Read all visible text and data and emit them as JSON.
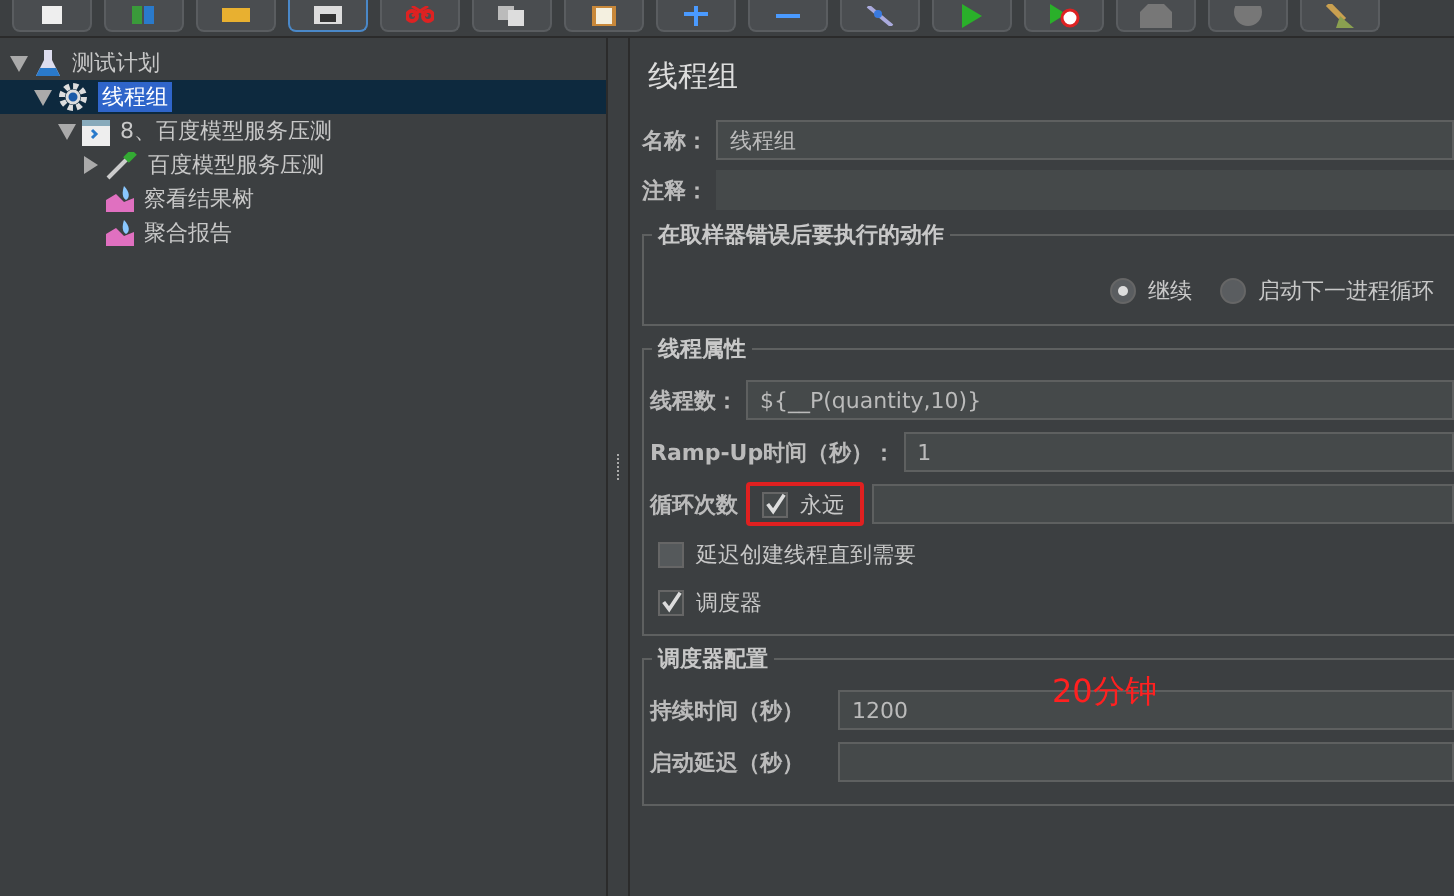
{
  "toolbar": [
    {
      "selected": false
    },
    {
      "selected": false
    },
    {
      "selected": false
    },
    {
      "selected": true
    },
    {
      "selected": false
    },
    {
      "selected": false
    },
    {
      "selected": false
    },
    {
      "selected": false
    },
    {
      "selected": false
    },
    {
      "selected": false
    },
    {
      "selected": false
    },
    {
      "selected": false
    },
    {
      "selected": false
    },
    {
      "selected": false
    },
    {
      "selected": false
    }
  ],
  "tree": [
    {
      "label": "测试计划",
      "kind": "plan",
      "expanded": true,
      "selected": false,
      "children": [
        {
          "label": "线程组",
          "kind": "thread-group",
          "expanded": true,
          "selected": true,
          "children": [
            {
              "label": "8、百度模型服务压测",
              "kind": "controller",
              "expanded": true,
              "selected": false,
              "children": [
                {
                  "label": "百度模型服务压测",
                  "kind": "sampler",
                  "expanded": false,
                  "selected": false
                },
                {
                  "label": "察看结果树",
                  "kind": "listener",
                  "selected": false
                },
                {
                  "label": "聚合报告",
                  "kind": "listener",
                  "selected": false
                }
              ]
            }
          ]
        }
      ]
    }
  ],
  "panel": {
    "title": "线程组",
    "name": {
      "label": "名称：",
      "value": "线程组"
    },
    "comment": {
      "label": "注释："
    },
    "error_action": {
      "legend": "在取样器错误后要执行的动作",
      "options": [
        {
          "label": "继续",
          "selected": true
        },
        {
          "label": "启动下一进程循环",
          "selected": false
        }
      ]
    },
    "thread_props": {
      "legend": "线程属性",
      "threads": {
        "label": "线程数：",
        "value": "${__P(quantity,10)}"
      },
      "rampup": {
        "label": "Ramp-Up时间（秒）：",
        "value": "1"
      },
      "loop": {
        "label": "循环次数",
        "forever_label": "永远",
        "forever": true
      },
      "checks": [
        {
          "label": "延迟创建线程直到需要",
          "checked": false
        },
        {
          "label": "调度器",
          "checked": true
        }
      ]
    },
    "scheduler": {
      "legend": "调度器配置",
      "duration": {
        "label": "持续时间（秒）",
        "value": "1200"
      },
      "delay": {
        "label": "启动延迟（秒）"
      }
    },
    "annotation": "20分钟"
  }
}
